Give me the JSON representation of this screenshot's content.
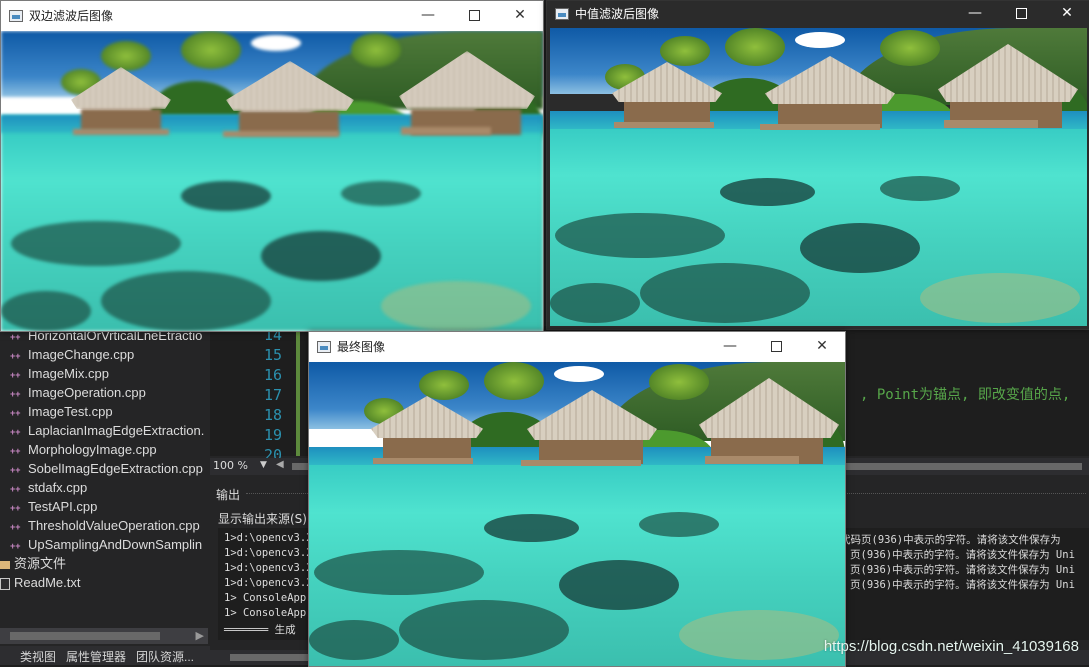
{
  "colors": {
    "ide_bg": "#252526",
    "editor_bg": "#1e1e1e",
    "line_number": "#2b91af",
    "comment": "#57a64a"
  },
  "solution_explorer": {
    "items": [
      {
        "label": "HorizontalOrVrticalLneEtractio",
        "icon": "cpp-file-icon"
      },
      {
        "label": "ImageChange.cpp",
        "icon": "cpp-file-icon"
      },
      {
        "label": "ImageMix.cpp",
        "icon": "cpp-file-icon"
      },
      {
        "label": "ImageOperation.cpp",
        "icon": "cpp-file-icon"
      },
      {
        "label": "ImageTest.cpp",
        "icon": "cpp-file-icon"
      },
      {
        "label": "LaplacianImagEdgeExtraction.",
        "icon": "cpp-file-icon"
      },
      {
        "label": "MorphologyImage.cpp",
        "icon": "cpp-file-icon"
      },
      {
        "label": "SobelImagEdgeExtraction.cpp",
        "icon": "cpp-file-icon"
      },
      {
        "label": "stdafx.cpp",
        "icon": "cpp-file-icon"
      },
      {
        "label": "TestAPI.cpp",
        "icon": "cpp-file-icon"
      },
      {
        "label": "ThresholdValueOperation.cpp",
        "icon": "cpp-file-icon"
      },
      {
        "label": "UpSamplingAndDownSamplin",
        "icon": "cpp-file-icon"
      }
    ],
    "resource_folder": "资源文件",
    "readme": "ReadMe.txt"
  },
  "bottom_tabs": [
    "类视图",
    "属性管理器",
    "团队资源..."
  ],
  "editor": {
    "line_numbers": [
      "14",
      "15",
      "16",
      "17",
      "18",
      "19",
      "20"
    ],
    "comment_text": ", Point为锚点, 即改变值的点,"
  },
  "zoom": {
    "value": "100 %"
  },
  "output": {
    "title": "输出",
    "source_label": "显示输出来源(S):",
    "lines": [
      "1>d:\\opencv3.2",
      "1>d:\\opencv3.2",
      "1>d:\\opencv3.2",
      "1>d:\\opencv3.2",
      "1>  ConsoleApp",
      "1>  ConsoleApp",
      "═══════ 生成"
    ],
    "line_tails": [
      "代码页(936)中表示的字符。请将该文件保存为",
      "页(936)中表示的字符。请将该文件保存为 Uni",
      "页(936)中表示的字符。请将该文件保存为 Uni",
      "页(936)中表示的字符。请将该文件保存为 Uni"
    ]
  },
  "windows": {
    "bilateral": {
      "title": "双边滤波后图像",
      "icon": "opencv-window-icon"
    },
    "median": {
      "title": "中值滤波后图像",
      "icon": "opencv-window-icon"
    },
    "final": {
      "title": "最终图像",
      "icon": "opencv-window-icon"
    }
  },
  "window_controls": {
    "minimize": "—",
    "close": "✕"
  },
  "watermark": "https://blog.csdn.net/weixin_41039168"
}
